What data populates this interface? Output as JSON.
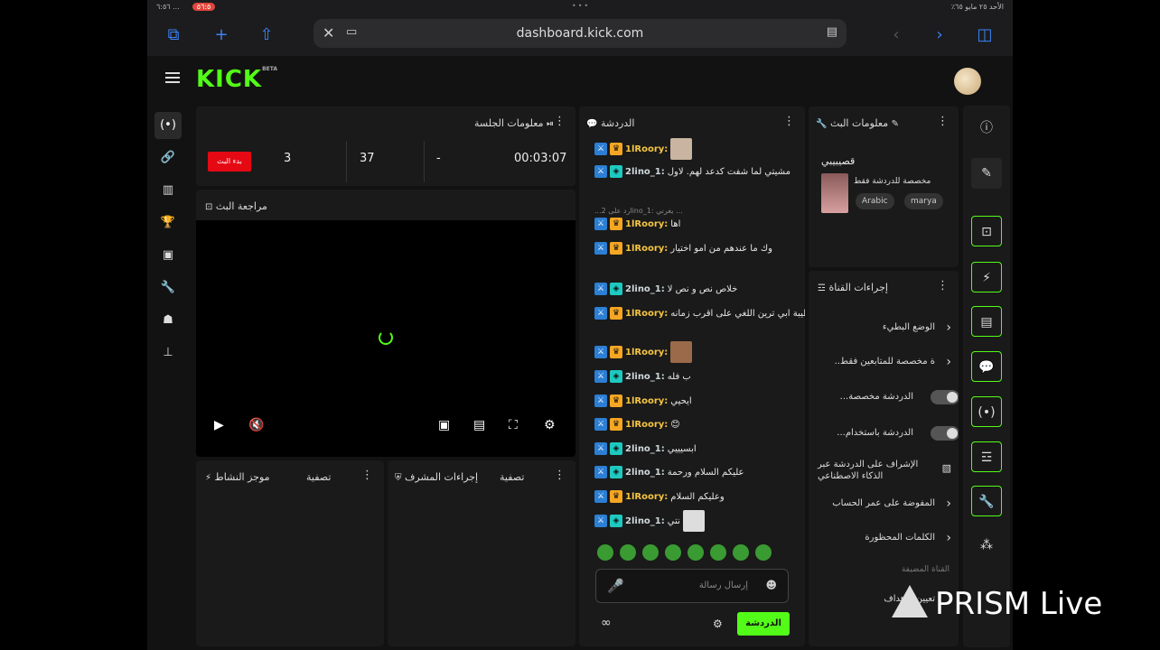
{
  "status_bar": {
    "left": "٦:٥٦ ...",
    "rec": "٥٦:٥",
    "right": "الأحد ٢٥ مايو ٦٥٪"
  },
  "browser": {
    "url": "dashboard.kick.com"
  },
  "app": {
    "logo": "KICK",
    "logo_badge": "BETA"
  },
  "session": {
    "title": "معلومات الجلسة",
    "start_button": "بدء البث",
    "stats": [
      "3",
      "37",
      "-",
      "00:03:07"
    ]
  },
  "preview": {
    "title": "مراجعة البث"
  },
  "activity": {
    "title": "موجز النشاط",
    "filter": "تصفية"
  },
  "mod_actions": {
    "title": "إجراءات المشرف",
    "filter": "تصفية"
  },
  "chat": {
    "title": "الدردشة",
    "messages": [
      {
        "user": "1lRoory:",
        "text": ""
      },
      {
        "user": "2lino_1:",
        "text": "مشيتي لما شفت كدعد لهم. لاول"
      },
      {
        "user": "",
        "text": "...رد على 2lino_1: يغرني ..."
      },
      {
        "user": "1lRoory:",
        "text": "اها"
      },
      {
        "user": "1lRoory:",
        "text": "وك ما عندهم من امو اختيار"
      },
      {
        "user": "2lino_1:",
        "text": "خلاص نص و نص لا"
      },
      {
        "user": "1lRoory:",
        "text": "يس طيبة ابي ترين اللغي على اقرب زمانه"
      },
      {
        "user": "1lRoory:",
        "text": ""
      },
      {
        "user": "2lino_1:",
        "text": "ب فله"
      },
      {
        "user": "1lRoory:",
        "text": "ايحيي"
      },
      {
        "user": "1lRoory:",
        "text": "😊"
      },
      {
        "user": "2lino_1:",
        "text": "ابسيييي"
      },
      {
        "user": "2lino_1:",
        "text": "عليكم السلام ورحمة"
      },
      {
        "user": "1lRoory:",
        "text": "وعليكم السلام"
      },
      {
        "user": "2lino_1:",
        "text": "نتي"
      }
    ],
    "input_placeholder": "إرسال رسالة",
    "send_button": "الدردشة",
    "footer_icon": "∞"
  },
  "stream_info": {
    "title": "معلومات البث",
    "stream_title": "قصيبيبي",
    "subtitle": "مخصصة للدردشة فقط",
    "tags": [
      "Arabic",
      "marya"
    ]
  },
  "channel_actions": {
    "title": "إجراءات القناة",
    "rows": [
      {
        "label": "الوضع البطيء",
        "type": "chevron"
      },
      {
        "label": "..ة مخصصة للمتابعين فقط",
        "type": "chevron"
      },
      {
        "label": "...الدردشة مخصصة",
        "type": "toggle"
      },
      {
        "label": "...الدردشة باستخدام",
        "type": "toggle"
      },
      {
        "label": "الإشراف على الدردشة عبر الذكاء الاصطناعي",
        "type": "icon"
      },
      {
        "label": "المفوضة على عمر الحساب",
        "type": "chevron"
      },
      {
        "label": "الكلمات المحظورة",
        "type": "chevron"
      }
    ],
    "section": "القناة المضيفة",
    "goals": "تعيين الأهداف"
  },
  "watermark": "PRISM Live"
}
